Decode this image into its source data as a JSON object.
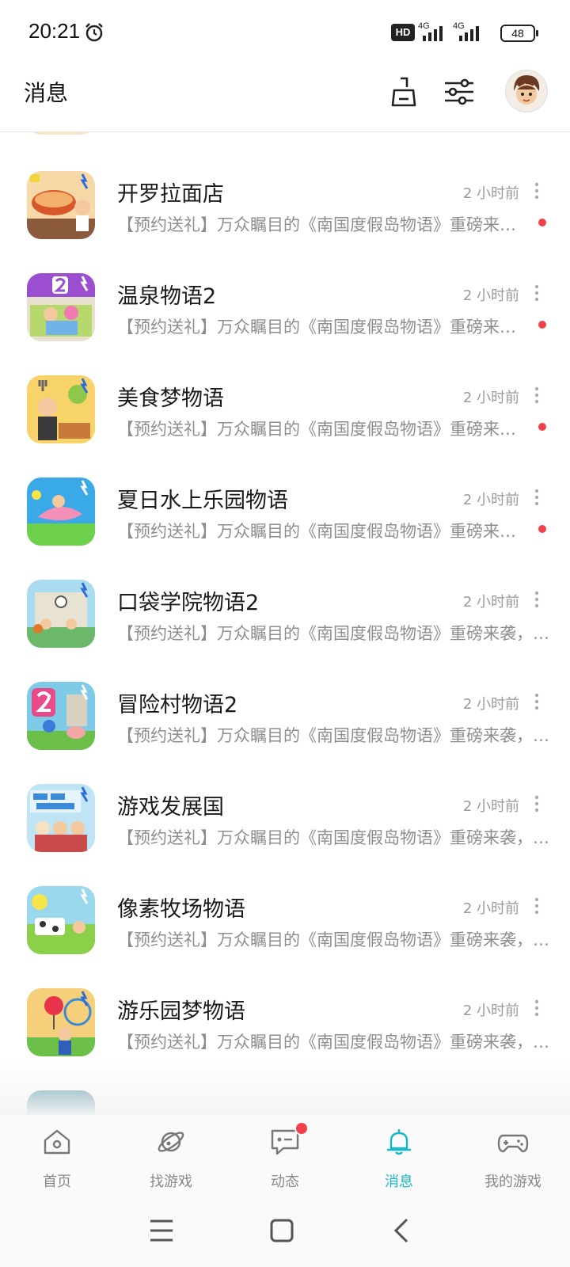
{
  "status_bar": {
    "time": "20:21",
    "hd": "HD",
    "net1": "4G",
    "net2": "4G",
    "battery": "48"
  },
  "header": {
    "title": "消息",
    "icons": [
      "clean-broom-icon",
      "filter-sliders-icon",
      "avatar"
    ]
  },
  "messages": [
    {
      "title": "开罗拉面店",
      "time": "2 小时前",
      "desc": "【预约送礼】万众瞩目的《南国度假岛物语》重磅来袭，现已开放预约",
      "unread": true,
      "icon": "ramen-game-icon"
    },
    {
      "title": "温泉物语2",
      "time": "2 小时前",
      "desc": "【预约送礼】万众瞩目的《南国度假岛物语》重磅来袭，现已开放预约",
      "unread": true,
      "icon": "hot-spring-game-icon"
    },
    {
      "title": "美食梦物语",
      "time": "2 小时前",
      "desc": "【预约送礼】万众瞩目的《南国度假岛物语》重磅来袭，现已开放预约",
      "unread": true,
      "icon": "food-dream-game-icon"
    },
    {
      "title": "夏日水上乐园物语",
      "time": "2 小时前",
      "desc": "【预约送礼】万众瞩目的《南国度假岛物语》重磅来袭，现已开放预约",
      "unread": true,
      "icon": "water-park-game-icon"
    },
    {
      "title": "口袋学院物语2",
      "time": "2 小时前",
      "desc": "【预约送礼】万众瞩目的《南国度假岛物语》重磅来袭，现已开放预约",
      "unread": false,
      "icon": "pocket-academy-game-icon"
    },
    {
      "title": "冒险村物语2",
      "time": "2 小时前",
      "desc": "【预约送礼】万众瞩目的《南国度假岛物语》重磅来袭，现已开放预约",
      "unread": false,
      "icon": "adventure-village-game-icon"
    },
    {
      "title": "游戏发展国",
      "time": "2 小时前",
      "desc": "【预约送礼】万众瞩目的《南国度假岛物语》重磅来袭，现已开放预约",
      "unread": false,
      "icon": "game-dev-story-icon"
    },
    {
      "title": "像素牧场物语",
      "time": "2 小时前",
      "desc": "【预约送礼】万众瞩目的《南国度假岛物语》重磅来袭，现已开放预约",
      "unread": false,
      "icon": "pixel-ranch-game-icon"
    },
    {
      "title": "游乐园梦物语",
      "time": "2 小时前",
      "desc": "【预约送礼】万众瞩目的《南国度假岛物语》重磅来袭，现已开放预约",
      "unread": false,
      "icon": "theme-park-game-icon"
    }
  ],
  "bottom_nav": [
    {
      "label": "首页",
      "icon": "home-icon",
      "active": false
    },
    {
      "label": "找游戏",
      "icon": "planet-icon",
      "active": false
    },
    {
      "label": "动态",
      "icon": "chat-bubble-icon",
      "active": false,
      "badge": true
    },
    {
      "label": "消息",
      "icon": "bell-icon",
      "active": true
    },
    {
      "label": "我的游戏",
      "icon": "gamepad-icon",
      "active": false
    }
  ],
  "colors": {
    "accent": "#19b8c8",
    "unread_dot": "#f0414a",
    "text_secondary": "#8e8e8e"
  }
}
